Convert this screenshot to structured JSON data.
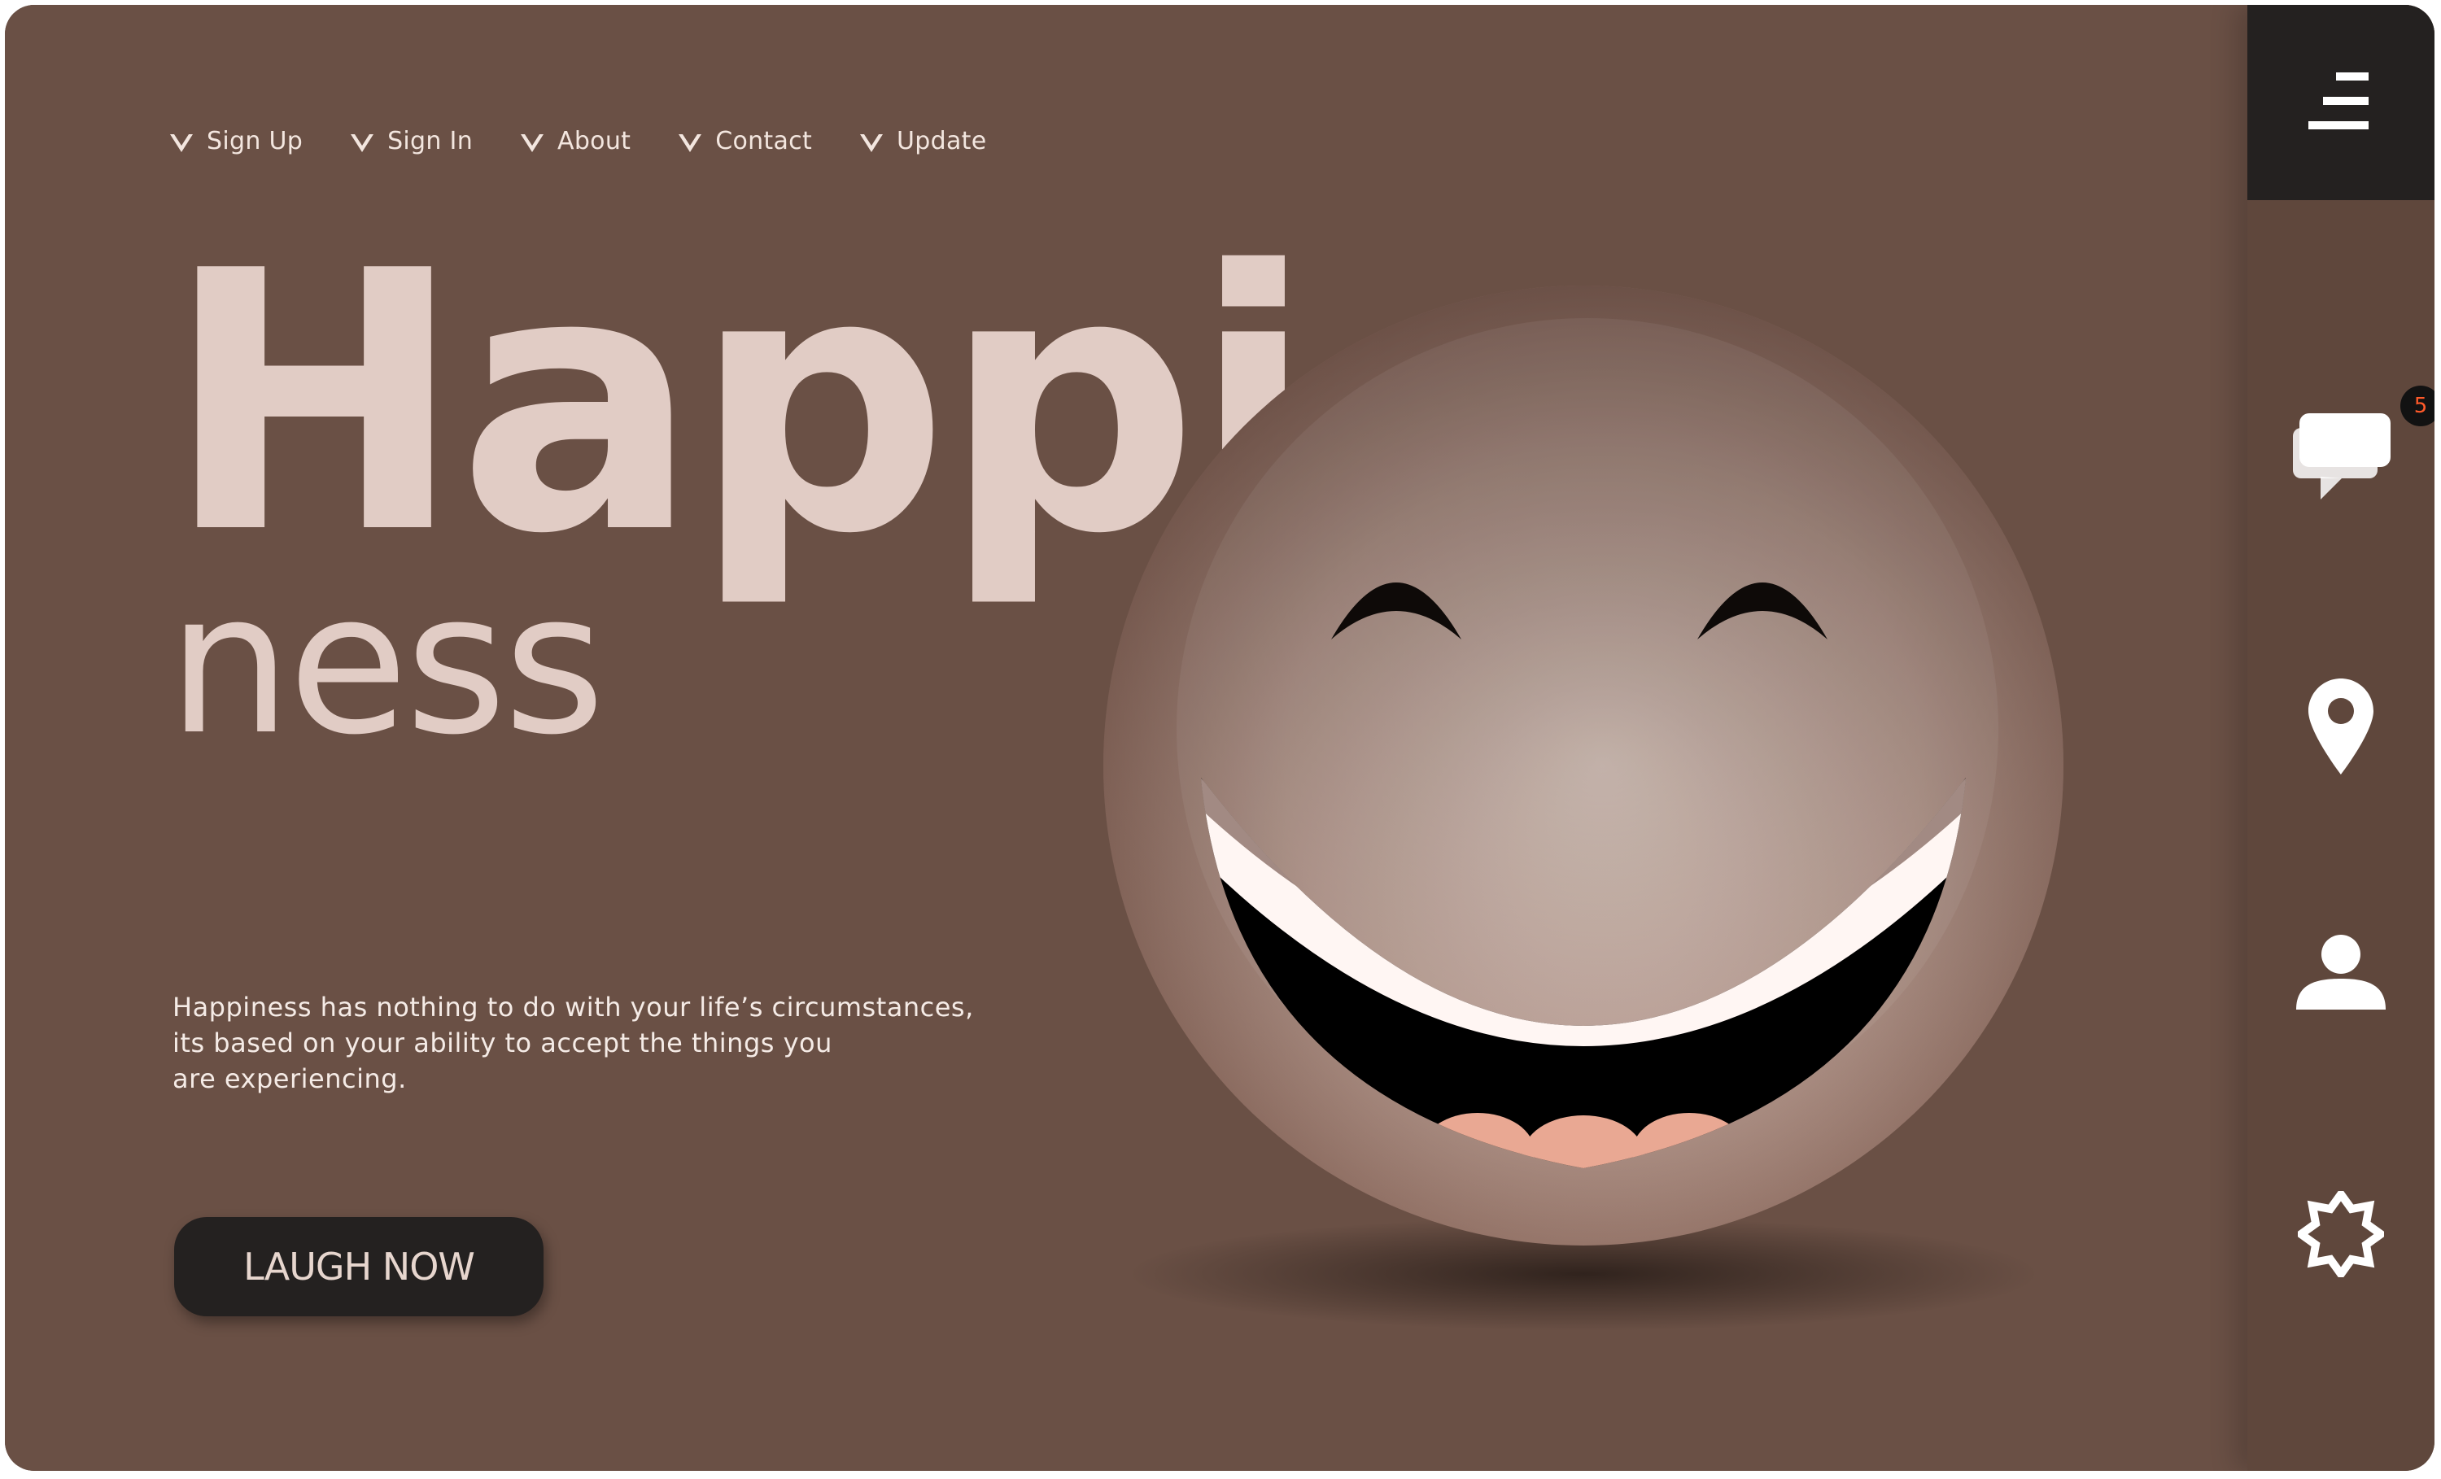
{
  "nav": {
    "items": [
      {
        "label": "Sign Up"
      },
      {
        "label": "Sign In"
      },
      {
        "label": "About"
      },
      {
        "label": "Contact"
      },
      {
        "label": "Update"
      }
    ]
  },
  "hero": {
    "title": "Happi",
    "subtitle": "ness",
    "description_lines": [
      "Happiness has nothing to do with your life’s circumstances,",
      "its based on your ability to accept the things you",
      "are experiencing."
    ],
    "cta_label": "LAUGH NOW"
  },
  "sidebar": {
    "menu_icon": "menu-icon",
    "items": [
      {
        "icon": "chat-icon",
        "badge": "5"
      },
      {
        "icon": "location-pin-icon"
      },
      {
        "icon": "user-icon"
      },
      {
        "icon": "settings-gear-icon"
      }
    ]
  },
  "colors": {
    "background": "#6a5045",
    "sidebar": "#5f473c",
    "dark": "#242120",
    "title": "#e1ccc5",
    "badge_text": "#ff5a2a"
  }
}
